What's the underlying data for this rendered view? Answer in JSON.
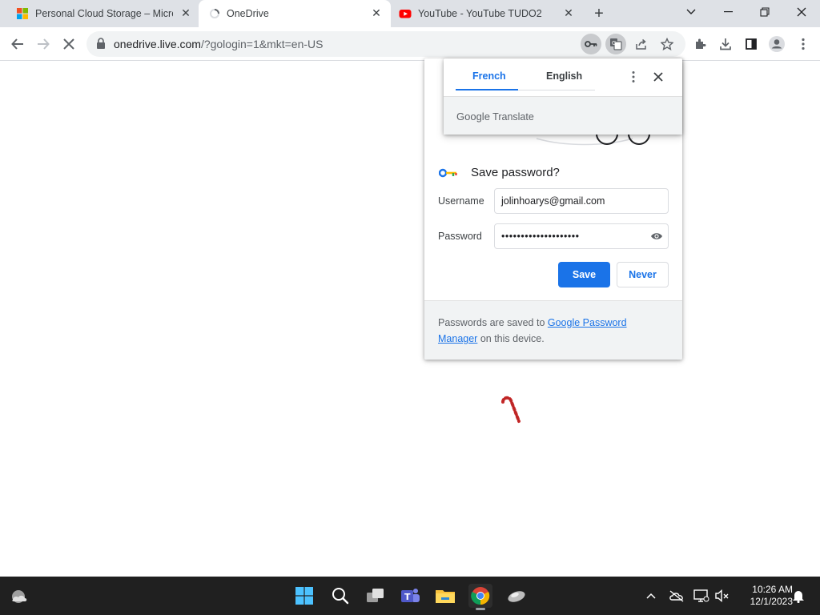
{
  "browser": {
    "tabs": [
      {
        "title": "Personal Cloud Storage – Micros",
        "favicon": "microsoft-icon",
        "active": false
      },
      {
        "title": "OneDrive",
        "favicon": "loading-spinner-icon",
        "active": true
      },
      {
        "title": "YouTube - YouTube TUDO2",
        "favicon": "youtube-icon",
        "active": false
      }
    ],
    "new_tab_label": "+",
    "address": {
      "host": "onedrive.live.com",
      "path": "/?gologin=1&mkt=en-US"
    }
  },
  "translate_bubble": {
    "tab_source": "French",
    "tab_target": "English",
    "brand_google": "Google",
    "brand_translate": "Translate"
  },
  "save_password": {
    "title": "Save password?",
    "username_label": "Username",
    "username_value": "jolinhoarys@gmail.com",
    "password_label": "Password",
    "password_mask": "••••••••••••••••••••",
    "save_label": "Save",
    "never_label": "Never",
    "footer_prefix": "Passwords are saved to ",
    "footer_link": "Google Password Manager",
    "footer_suffix": " on this device."
  },
  "taskbar": {
    "time": "10:26 AM",
    "date": "12/1/2023"
  },
  "colors": {
    "accent": "#1a73e8",
    "tabstrip": "#dee1e6",
    "taskbar": "#202020"
  }
}
